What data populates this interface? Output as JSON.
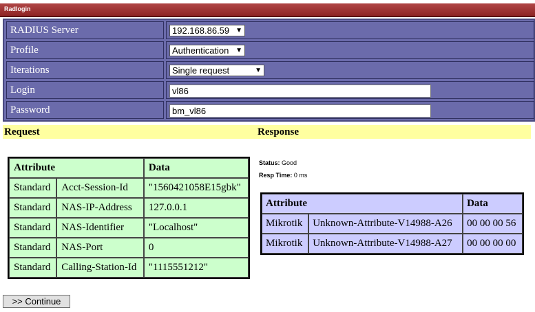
{
  "app": {
    "title": "Radlogin"
  },
  "form": {
    "server": {
      "label": "RADIUS Server",
      "value": "192.168.86.59"
    },
    "profile": {
      "label": "Profile",
      "value": "Authentication"
    },
    "iterations": {
      "label": "Iterations",
      "value": "Single request"
    },
    "login": {
      "label": "Login",
      "value": "vl86"
    },
    "password": {
      "label": "Password",
      "value": "bm_vl86"
    }
  },
  "request": {
    "heading": "Request",
    "col_attribute": "Attribute",
    "col_data": "Data",
    "rows": [
      {
        "type": "Standard",
        "name": "Acct-Session-Id",
        "data": "\"1560421058E15gbk\""
      },
      {
        "type": "Standard",
        "name": "NAS-IP-Address",
        "data": "127.0.0.1"
      },
      {
        "type": "Standard",
        "name": "NAS-Identifier",
        "data": "\"Localhost\""
      },
      {
        "type": "Standard",
        "name": "NAS-Port",
        "data": "0"
      },
      {
        "type": "Standard",
        "name": "Calling-Station-Id",
        "data": "\"1115551212\""
      }
    ]
  },
  "response": {
    "heading": "Response",
    "status_label": "Status:",
    "status_value": "Good",
    "resp_time_label": "Resp Time:",
    "resp_time_value": "0 ms",
    "col_attribute": "Attribute",
    "col_data": "Data",
    "rows": [
      {
        "type": "Mikrotik",
        "name": "Unknown-Attribute-V14988-A26",
        "data": "00 00 00 56"
      },
      {
        "type": "Mikrotik",
        "name": "Unknown-Attribute-V14988-A27",
        "data": "00 00 00 00"
      }
    ]
  },
  "continue_label": ">> Continue"
}
